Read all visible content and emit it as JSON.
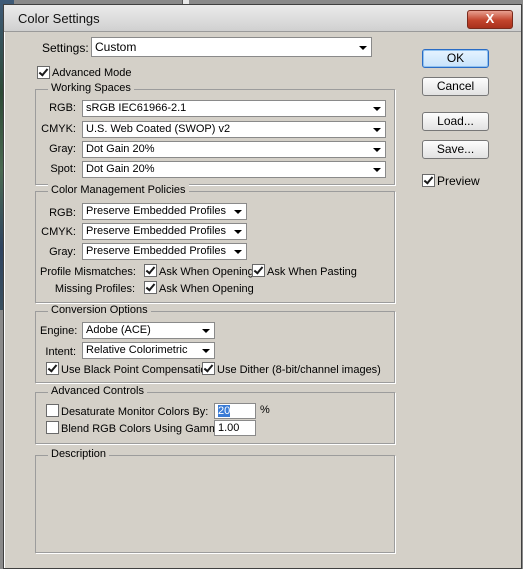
{
  "window": {
    "title": "Color Settings",
    "close_label": "X"
  },
  "settings": {
    "label": "Settings:",
    "value": "Custom"
  },
  "advanced_mode": {
    "label": "Advanced Mode",
    "checked": true
  },
  "working_spaces": {
    "title": "Working Spaces",
    "rgb": {
      "label": "RGB:",
      "value": "sRGB IEC61966-2.1"
    },
    "cmyk": {
      "label": "CMYK:",
      "value": "U.S. Web Coated (SWOP) v2"
    },
    "gray": {
      "label": "Gray:",
      "value": "Dot Gain 20%"
    },
    "spot": {
      "label": "Spot:",
      "value": "Dot Gain 20%"
    }
  },
  "policies": {
    "title": "Color Management Policies",
    "rgb": {
      "label": "RGB:",
      "value": "Preserve Embedded Profiles"
    },
    "cmyk": {
      "label": "CMYK:",
      "value": "Preserve Embedded Profiles"
    },
    "gray": {
      "label": "Gray:",
      "value": "Preserve Embedded Profiles"
    },
    "mismatches_label": "Profile Mismatches:",
    "ask_opening_label": "Ask When Opening",
    "ask_pasting_label": "Ask When Pasting",
    "missing_label": "Missing Profiles:",
    "missing_ask_opening_label": "Ask When Opening"
  },
  "conversion": {
    "title": "Conversion Options",
    "engine": {
      "label": "Engine:",
      "value": "Adobe (ACE)"
    },
    "intent": {
      "label": "Intent:",
      "value": "Relative Colorimetric"
    },
    "bpc_label": "Use Black Point Compensation",
    "dither_label": "Use Dither (8-bit/channel images)"
  },
  "advanced": {
    "title": "Advanced Controls",
    "desaturate_label": "Desaturate Monitor Colors By:",
    "desaturate_value": "20",
    "percent": "%",
    "blend_label": "Blend RGB Colors Using Gamma:",
    "blend_value": "1.00"
  },
  "description": {
    "title": "Description"
  },
  "buttons": {
    "ok": "OK",
    "cancel": "Cancel",
    "load": "Load...",
    "save": "Save..."
  },
  "preview": {
    "label": "Preview",
    "checked": true
  }
}
